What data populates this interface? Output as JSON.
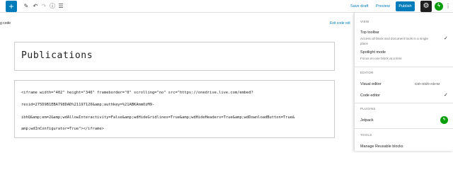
{
  "toolbar": {
    "add_icon": "plus-icon",
    "save_draft": "Save draft",
    "preview": "Preview",
    "publish": "Publish",
    "accent_color": "#007cba"
  },
  "editor": {
    "mode_label": "g code",
    "exit_code": "Exit code edi",
    "title": "Publications",
    "code_lines": [
      "<iframe width=\"402\" height=\"346\" frameborder=\"0\" scrolling=\"no\" src=\"https://onedrive.live.com/embed?",
      "resid=275D9B1EBA798DAD%21197126&amp;authkey=%21ABKAmmOzM9-",
      "ibhQ&amp;em=2&amp;wdAllowInteractivity=False&amp;wdHideGridlines=True&amp;wdHideHeaders=True&amp;wdDownloadButton=True&",
      "amp;wdInConfigurator=True\"></iframe>"
    ]
  },
  "menu": {
    "view": {
      "heading": "VIEW",
      "top_toolbar_label": "Top toolbar",
      "top_toolbar_desc": "Access all block and document tools in a single place",
      "spotlight_label": "Spotlight mode",
      "spotlight_desc": "Focus on one block at a time"
    },
    "editor": {
      "heading": "EDITOR",
      "visual_label": "Visual editor",
      "visual_shortcut": "Ctrl+Shift+Alt+M",
      "code_label": "Code editor"
    },
    "plugins": {
      "heading": "PLUGINS",
      "jetpack_label": "Jetpack"
    },
    "tools": {
      "heading": "TOOLS",
      "manage_blocks_label": "Manage Reusable blocks"
    }
  }
}
